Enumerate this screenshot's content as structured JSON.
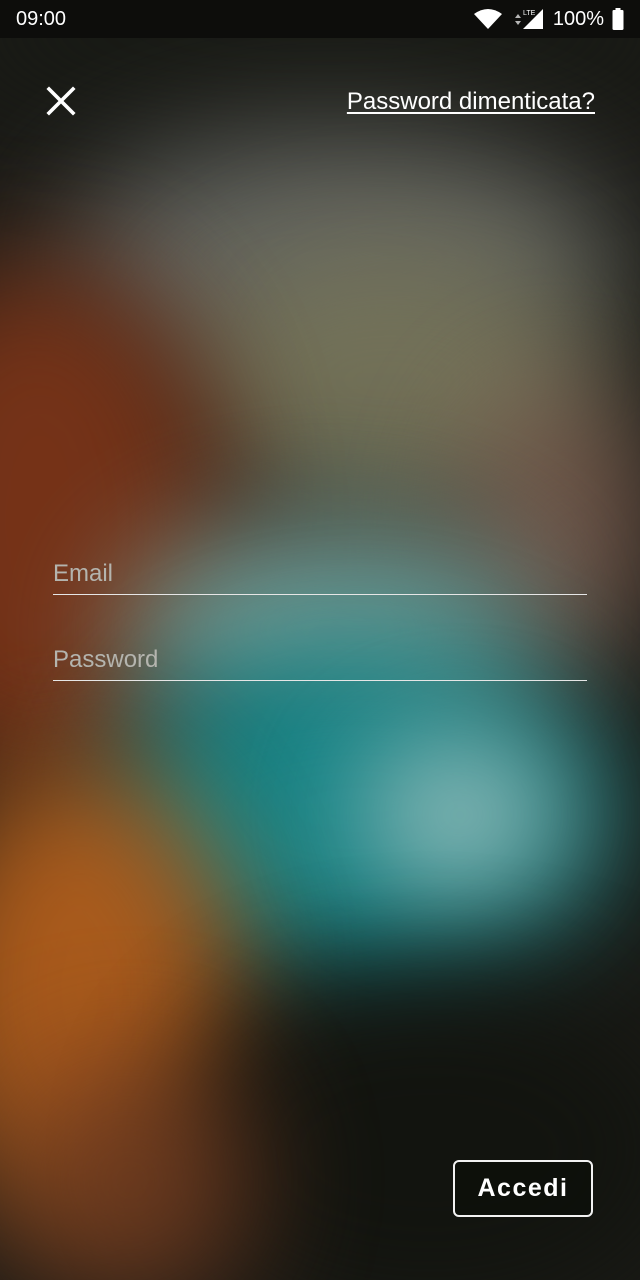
{
  "status_bar": {
    "time": "09:00",
    "network_label": "LTE",
    "battery": "100%",
    "icons": [
      "wifi-icon",
      "signal-icon",
      "battery-icon"
    ]
  },
  "header": {
    "close_icon": "close-icon",
    "forgot_password": "Password dimenticata?"
  },
  "form": {
    "email": {
      "value": "",
      "placeholder": "Email"
    },
    "password": {
      "value": "",
      "placeholder": "Password"
    }
  },
  "submit": {
    "label": "Accedi"
  },
  "colors": {
    "text": "#ffffff",
    "placeholder": "#b4b4ae",
    "status_bar_bg": "#0d0d0b",
    "underline": "#e6e6e6"
  }
}
